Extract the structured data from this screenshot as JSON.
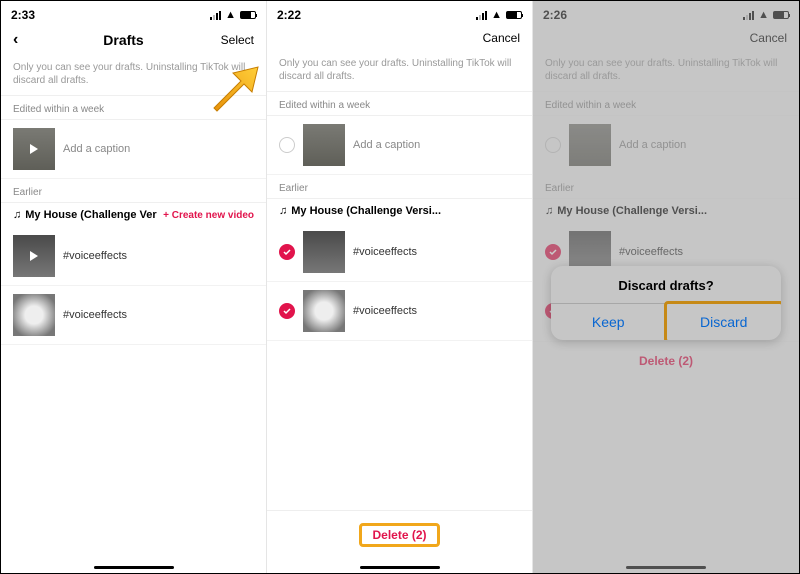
{
  "panel1": {
    "time": "2:33",
    "title": "Drafts",
    "select": "Select",
    "tip": "Only you can see your drafts. Uninstalling TikTok will discard all drafts.",
    "sec1": "Edited within a week",
    "row1cap": "Add a caption",
    "sec2": "Earlier",
    "song": "My House (Challenge Versi...",
    "cnv": "+ Create new video",
    "row2cap": "#voiceeffects",
    "row3cap": "#voiceeffects"
  },
  "panel2": {
    "time": "2:22",
    "cancel": "Cancel",
    "tip": "Only you can see your drafts. Uninstalling TikTok will discard all drafts.",
    "sec1": "Edited within a week",
    "row1cap": "Add a caption",
    "sec2": "Earlier",
    "song": "My House (Challenge Versi...",
    "row2cap": "#voiceeffects",
    "row3cap": "#voiceeffects",
    "delete": "Delete (2)"
  },
  "panel3": {
    "time": "2:26",
    "cancel": "Cancel",
    "tip": "Only you can see your drafts. Uninstalling TikTok will discard all drafts.",
    "sec1": "Edited within a week",
    "row1cap": "Add a caption",
    "sec2": "Earlier",
    "song": "My House (Challenge Versi...",
    "row2cap": "#voiceeffects",
    "row3cap": "#voiceeffects",
    "delete": "Delete (2)",
    "alertTitle": "Discard drafts?",
    "keep": "Keep",
    "discard": "Discard"
  }
}
